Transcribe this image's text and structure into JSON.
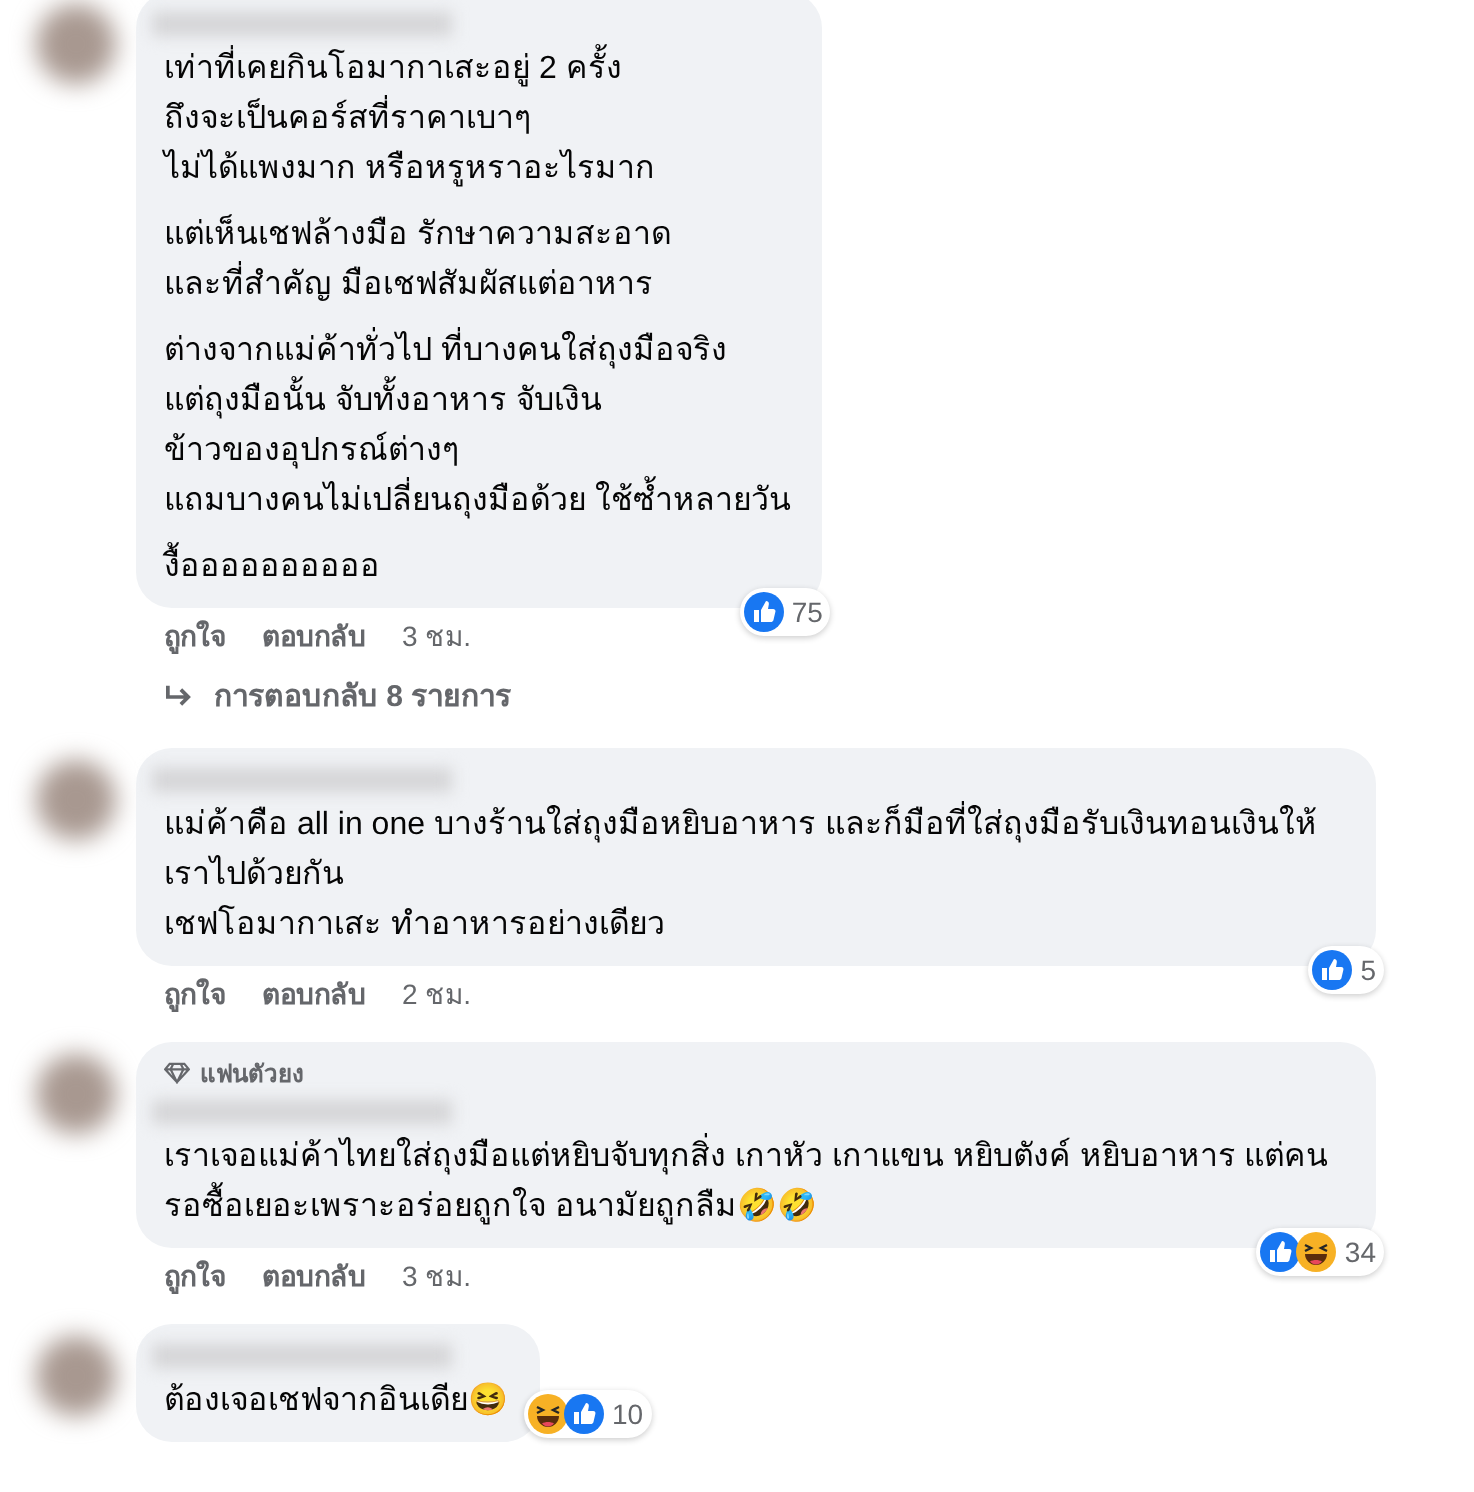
{
  "comments": [
    {
      "paragraphs": [
        [
          "เท่าที่เคยกินโอมากาเสะอยู่ 2 ครั้ง",
          "ถึงจะเป็นคอร์สที่ราคาเบาๆ",
          "ไม่ได้แพงมาก หรือหรูหราอะไรมาก"
        ],
        [
          "แต่เห็นเชฟล้างมือ รักษาความสะอาด",
          "และที่สำคัญ มือเชฟสัมผัสแต่อาหาร"
        ],
        [
          "ต่างจากแม่ค้าทั่วไป ที่บางคนใส่ถุงมือจริง",
          "แต่ถุงมือนั้น จับทั้งอาหาร จับเงิน",
          "ข้าวของอุปกรณ์ต่างๆ",
          "แถมบางคนไม่เปลี่ยนถุงมือด้วย ใช้ซ้ำหลายวัน"
        ],
        [
          "งื้ออออออออออ"
        ]
      ],
      "reactions": {
        "types": [
          {
            "kind": "like"
          }
        ],
        "count": "75"
      },
      "actions": {
        "like": "ถูกใจ",
        "reply": "ตอบกลับ",
        "time": "3 ชม."
      },
      "replies": "การตอบกลับ 8 รายการ"
    },
    {
      "paragraphs": [
        [
          "แม่ค้าคือ all in one บางร้านใส่ถุงมือหยิบอาหาร และก็มือที่ใส่ถุงมือรับเงินทอนเงินให้เราไปด้วยกัน",
          "เชฟโอมากาเสะ ทำอาหารอย่างเดียว"
        ]
      ],
      "reactions": {
        "types": [
          {
            "kind": "like"
          }
        ],
        "count": "5"
      },
      "actions": {
        "like": "ถูกใจ",
        "reply": "ตอบกลับ",
        "time": "2 ชม."
      }
    },
    {
      "badge": "แฟนตัวยง",
      "paragraphs": [
        [
          "เราเจอแม่ค้าไทยใส่ถุงมือแต่หยิบจับทุกสิ่ง เกาหัว เกาแขน หยิบตังค์ หยิบอาหาร แต่คนรอซื้อเยอะเพราะอร่อยถูกใจ อนามัยถูกลืม🤣🤣"
        ]
      ],
      "reactions": {
        "types": [
          {
            "kind": "like"
          },
          {
            "kind": "haha"
          }
        ],
        "count": "34"
      },
      "actions": {
        "like": "ถูกใจ",
        "reply": "ตอบกลับ",
        "time": "3 ชม."
      }
    },
    {
      "paragraphs": [
        [
          "ต้องเจอเชฟจากอินเดีย😆"
        ]
      ],
      "reactions": {
        "beside_bubble": true,
        "types": [
          {
            "kind": "haha"
          },
          {
            "kind": "like"
          }
        ],
        "count": "10"
      }
    }
  ]
}
